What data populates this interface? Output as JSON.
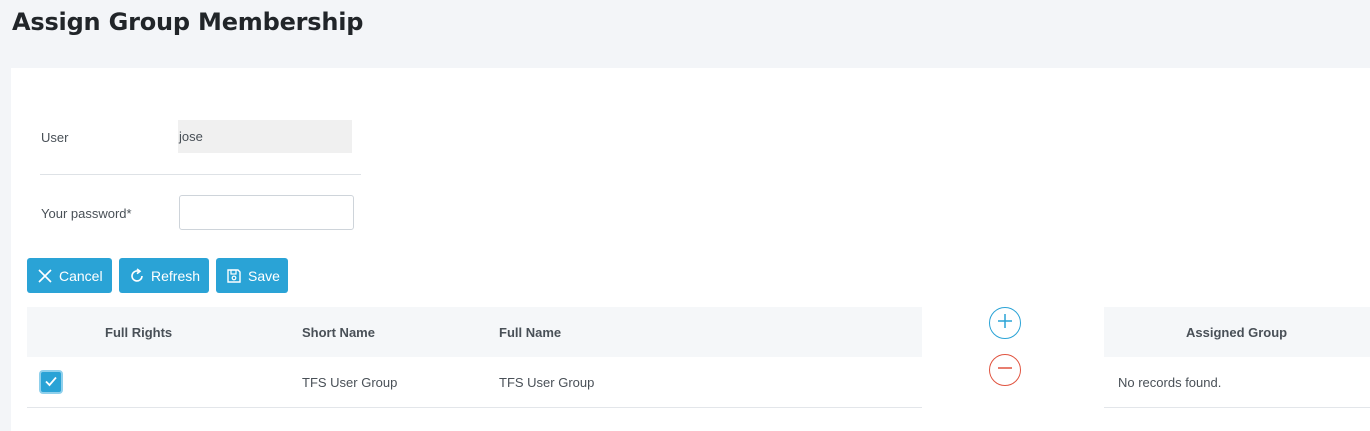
{
  "page": {
    "title": "Assign Group Membership"
  },
  "form": {
    "user_label": "User",
    "user_value": "jose",
    "password_label": "Your password*",
    "password_value": ""
  },
  "toolbar": {
    "cancel_label": "Cancel",
    "refresh_label": "Refresh",
    "save_label": "Save"
  },
  "groups_table": {
    "columns": [
      "Full Rights",
      "Short Name",
      "Full Name"
    ],
    "rows": [
      {
        "full_rights": true,
        "short_name": "TFS User Group",
        "full_name": "TFS User Group"
      }
    ]
  },
  "assigned_table": {
    "columns": [
      "Assigned Group"
    ],
    "empty_message": "No records found."
  },
  "colors": {
    "accent": "#2aa3d6",
    "danger": "#e0533f",
    "background": "#f3f5f8"
  },
  "icons": {
    "cancel": "close-icon",
    "refresh": "refresh-icon",
    "save": "save-icon",
    "add": "plus-icon",
    "remove": "minus-icon",
    "check": "check-icon"
  }
}
